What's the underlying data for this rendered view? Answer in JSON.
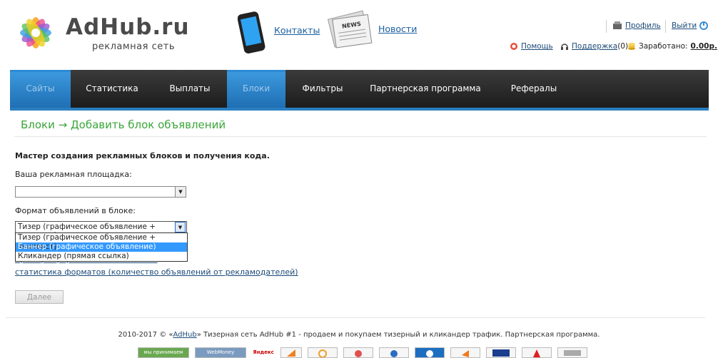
{
  "header": {
    "logo_title": "AdHub.ru",
    "logo_subtitle": "рекламная сеть",
    "contacts_label": "Контакты",
    "news_label": "Новости",
    "news_icon_text": "NEWS",
    "profile_label": "Профиль",
    "logout_label": "Выйти",
    "help_label": "Помощь",
    "support_label": "Поддержка",
    "support_count": "(0)",
    "earned_label": "Заработано:",
    "earned_value": "0.00р."
  },
  "nav": {
    "items": [
      {
        "label": "Сайты",
        "active": true
      },
      {
        "label": "Статистика",
        "active": false
      },
      {
        "label": "Выплаты",
        "active": false
      },
      {
        "label": "Блоки",
        "active": true
      },
      {
        "label": "Фильтры",
        "active": false
      },
      {
        "label": "Партнерская программа",
        "active": false
      },
      {
        "label": "Рефералы",
        "active": false
      }
    ],
    "accent_color": "#2a7fc0"
  },
  "page": {
    "title": "Блоки → Добавить блок объявлений",
    "intro": "Мастер создания рекламных блоков и получения кода.",
    "platform_label": "Ваша рекламная площадка:",
    "platform_value": "",
    "format_label": "Формат объявлений в блоке:",
    "format_value": "Тизер (графическое объявление + контекст)",
    "format_options": [
      {
        "label": "Тизер (графическое объявление + контекст)",
        "highlighted": false
      },
      {
        "label": "Баннер (графическое объявление)",
        "highlighted": true
      },
      {
        "label": "Кликандер (прямая ссылка)",
        "highlighted": false
      }
    ],
    "examples_link": "примеры форматов и их описание",
    "stats_link": "статистика форматов (количество объявлений от рекламодателей)",
    "next_button": "Далее"
  },
  "footer": {
    "year": "2010-2017 ©",
    "brand_link": "AdHub",
    "text": "Тизерная сеть AdHub #1 - продаем и покупаем тизерный и кликандер трафик. Партнерская программа.",
    "badges": [
      "мы принимаем",
      "WebMoney",
      "Яндекс"
    ]
  }
}
